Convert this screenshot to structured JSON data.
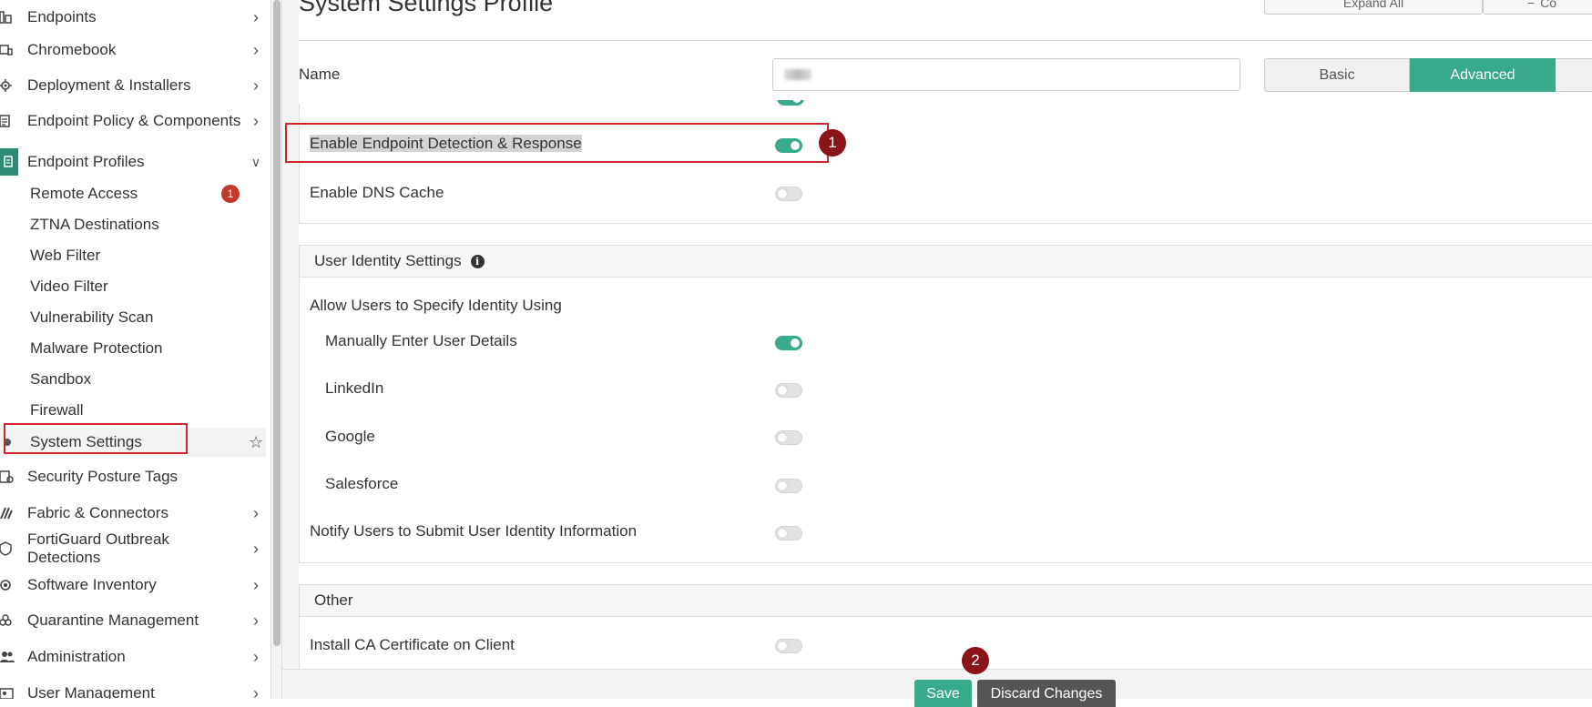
{
  "page": {
    "title": "System Settings Profile",
    "expand_all": "Expand All",
    "collapse_label": "Co"
  },
  "sidebar": {
    "items": [
      {
        "label": "Endpoints",
        "icon": "endpoints-icon"
      },
      {
        "label": "Chromebook",
        "icon": "chromebook-icon"
      },
      {
        "label": "Deployment & Installers",
        "icon": "gear-icon"
      },
      {
        "label": "Endpoint Policy & Components",
        "icon": "policy-icon"
      },
      {
        "label": "Endpoint Profiles",
        "icon": "profiles-icon"
      },
      {
        "label": "Security Posture Tags",
        "icon": "tags-icon"
      },
      {
        "label": "Fabric & Connectors",
        "icon": "fabric-icon"
      },
      {
        "label": "FortiGuard Outbreak Detections",
        "icon": "outbreak-icon"
      },
      {
        "label": "Software Inventory",
        "icon": "inventory-icon"
      },
      {
        "label": "Quarantine Management",
        "icon": "biohazard-icon"
      },
      {
        "label": "Administration",
        "icon": "users-icon"
      },
      {
        "label": "User Management",
        "icon": "user-card-icon"
      }
    ],
    "sub_items": [
      {
        "label": "Remote Access",
        "badge": "1"
      },
      {
        "label": "ZTNA Destinations"
      },
      {
        "label": "Web Filter"
      },
      {
        "label": "Video Filter"
      },
      {
        "label": "Vulnerability Scan"
      },
      {
        "label": "Malware Protection"
      },
      {
        "label": "Sandbox"
      },
      {
        "label": "Firewall"
      },
      {
        "label": "System Settings"
      }
    ]
  },
  "form": {
    "name_label": "Name",
    "name_value": "",
    "mode_basic": "Basic",
    "mode_advanced": "Advanced",
    "mode_selected": "Advanced"
  },
  "general": {
    "rows": [
      {
        "label": "Enable Endpoint Detection & Response",
        "on": true
      },
      {
        "label": "Enable DNS Cache",
        "on": false
      }
    ]
  },
  "identity": {
    "header": "User Identity Settings",
    "allow_label": "Allow Users to Specify Identity Using",
    "options": [
      {
        "label": "Manually Enter User Details",
        "on": true
      },
      {
        "label": "LinkedIn",
        "on": false
      },
      {
        "label": "Google",
        "on": false
      },
      {
        "label": "Salesforce",
        "on": false
      }
    ],
    "notify_label": "Notify Users to Submit User Identity Information",
    "notify_on": false
  },
  "other": {
    "header": "Other",
    "rows": [
      {
        "label": "Install CA Certificate on Client",
        "on": false
      }
    ]
  },
  "footer": {
    "save": "Save",
    "discard": "Discard Changes"
  },
  "markers": {
    "m1": "1",
    "m2": "2"
  },
  "colors": {
    "accent": "#3aaa8c",
    "badge": "#c0392b",
    "marker": "#8b1418",
    "highlight": "#d0262e"
  }
}
